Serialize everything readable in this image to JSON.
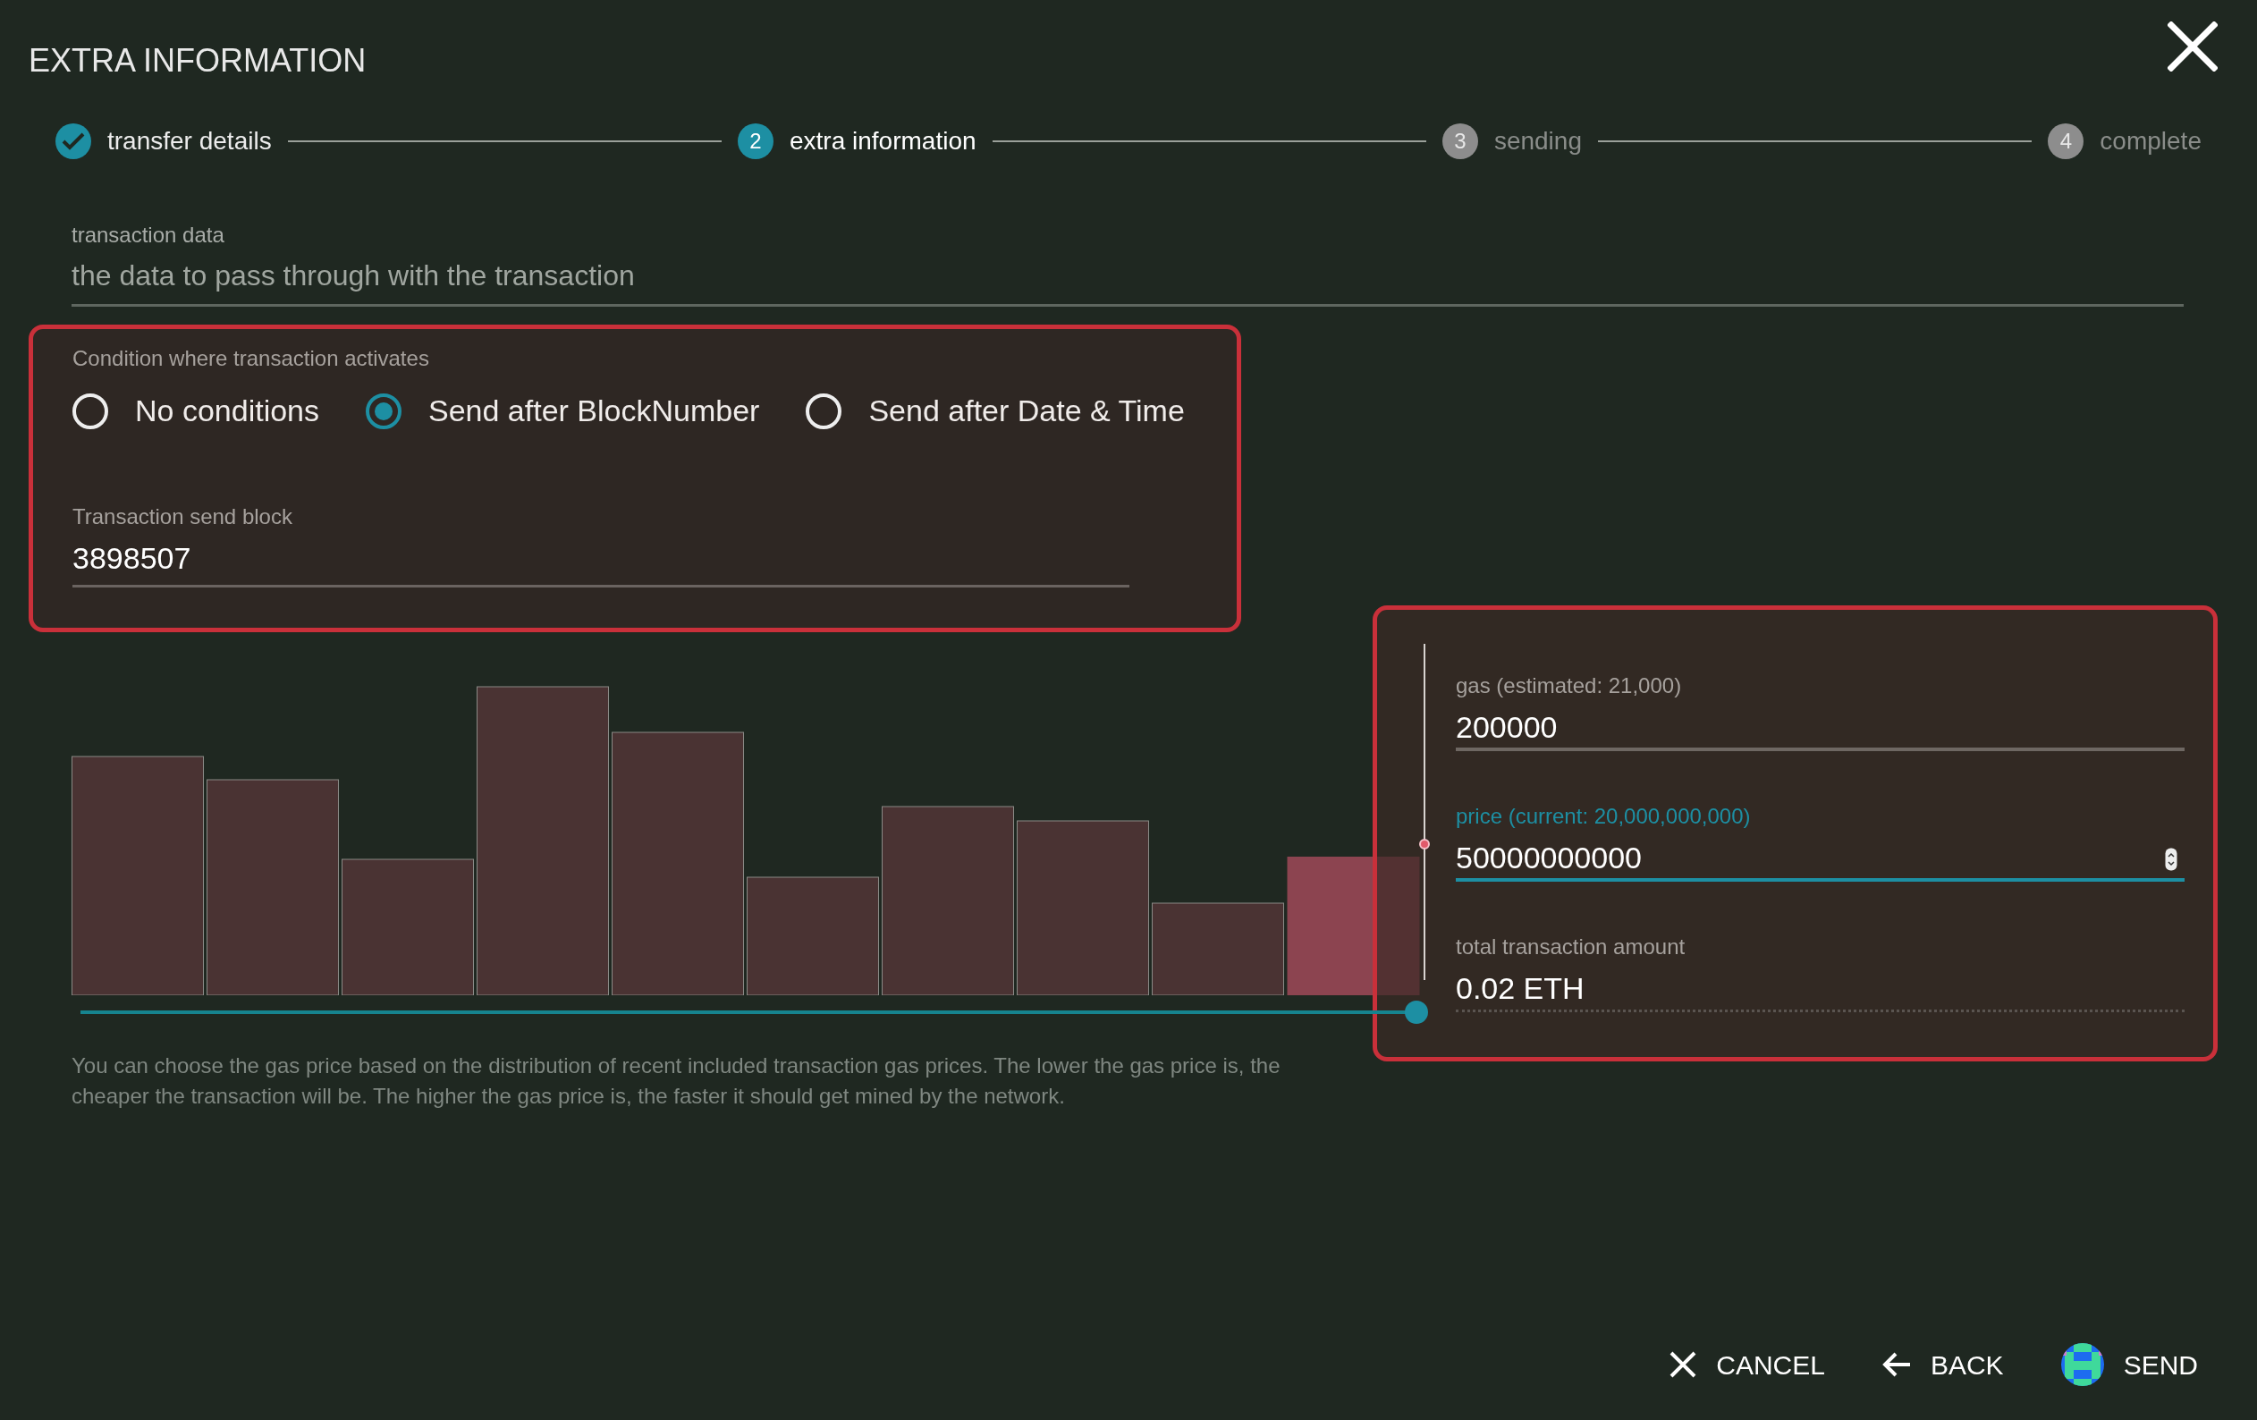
{
  "title": "EXTRA INFORMATION",
  "steps": [
    {
      "label": "transfer details",
      "done": true,
      "selected": false
    },
    {
      "number": "2",
      "label": "extra information",
      "done": false,
      "selected": true
    },
    {
      "number": "3",
      "label": "sending",
      "done": false,
      "selected": false
    },
    {
      "number": "4",
      "label": "complete",
      "done": false,
      "selected": false
    }
  ],
  "transaction_data": {
    "label": "transaction data",
    "placeholder": "the data to pass through with the transaction"
  },
  "condition": {
    "label": "Condition where transaction activates",
    "options": [
      {
        "label": "No conditions",
        "selected": false
      },
      {
        "label": "Send after BlockNumber",
        "selected": true
      },
      {
        "label": "Send after Date & Time",
        "selected": false
      }
    ],
    "block_field": {
      "label": "Transaction send block",
      "value": "3898507"
    }
  },
  "gas_slider": {
    "level": 1
  },
  "gas_note": "You can choose the gas price based on the distribution of recent included transaction gas prices. The lower the gas price is, the cheaper the transaction will be. The higher the gas price is, the faster it should get mined by the network.",
  "gas": {
    "label": "gas (estimated: 21,000)",
    "value": "200000"
  },
  "price": {
    "label": "price (current: 20,000,000,000)",
    "value": "50000000000",
    "focused": true
  },
  "total": {
    "label": "total transaction amount",
    "value": "0.02 ETH"
  },
  "buttons": [
    {
      "label": "CANCEL",
      "kind": "cancel"
    },
    {
      "label": "BACK",
      "kind": "back"
    },
    {
      "label": "SEND",
      "kind": "send"
    }
  ]
}
